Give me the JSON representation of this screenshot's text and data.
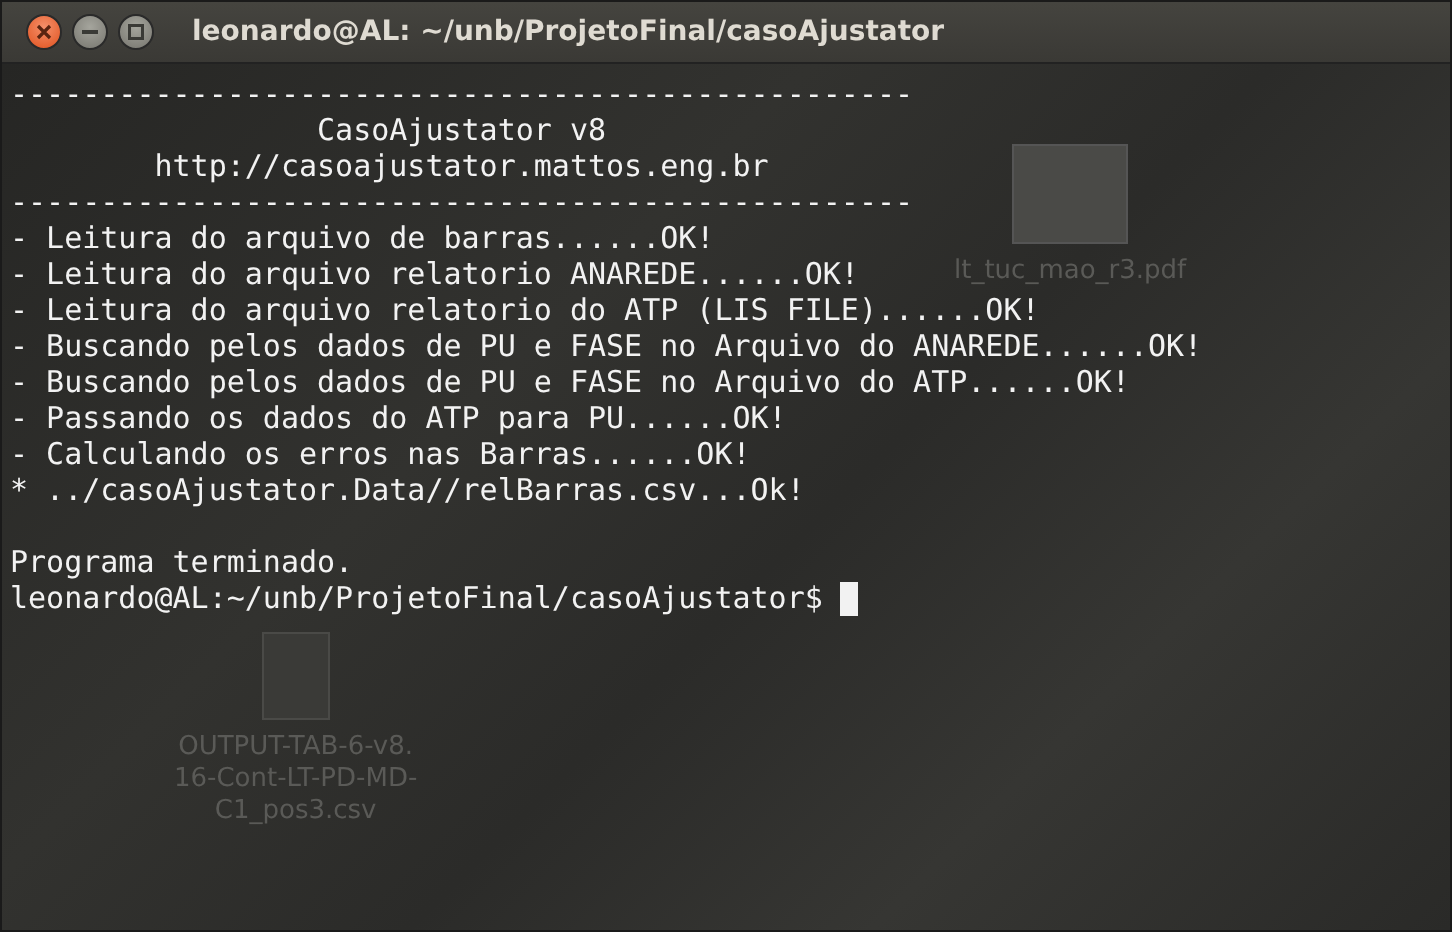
{
  "window": {
    "title": "leonardo@AL: ~/unb/ProjetoFinal/casoAjustator"
  },
  "terminal": {
    "lines": [
      {
        "kind": "rule",
        "text": "--------------------------------------------------"
      },
      {
        "kind": "center",
        "text": "CasoAjustator v8"
      },
      {
        "kind": "center",
        "text": "http://casoajustator.mattos.eng.br"
      },
      {
        "kind": "rule",
        "text": "--------------------------------------------------"
      },
      {
        "kind": "output",
        "text": "- Leitura do arquivo de barras......OK!"
      },
      {
        "kind": "output",
        "text": "- Leitura do arquivo relatorio ANAREDE......OK!"
      },
      {
        "kind": "output",
        "text": "- Leitura do arquivo relatorio do ATP (LIS FILE)......OK!"
      },
      {
        "kind": "output",
        "text": "- Buscando pelos dados de PU e FASE no Arquivo do ANAREDE......OK!"
      },
      {
        "kind": "output",
        "text": "- Buscando pelos dados de PU e FASE no Arquivo do ATP......OK!"
      },
      {
        "kind": "output",
        "text": "- Passando os dados do ATP para PU......OK!"
      },
      {
        "kind": "output",
        "text": "- Calculando os erros nas Barras......OK!"
      },
      {
        "kind": "output",
        "text": "* ../casoAjustator.Data//relBarras.csv...Ok!"
      },
      {
        "kind": "blank"
      },
      {
        "kind": "output",
        "text": "Programa terminado."
      }
    ],
    "prompt": "leonardo@AL:~/unb/ProjetoFinal/casoAjustator$",
    "cursor": true
  },
  "desktop_icons": [
    {
      "kind": "pdf",
      "label": "lt_tuc_mao_r3.pdf"
    },
    {
      "kind": "csv",
      "label": "OUTPUT-TAB-6-v8.\n16-Cont-LT-PD-MD-\nC1_pos3.csv"
    }
  ]
}
